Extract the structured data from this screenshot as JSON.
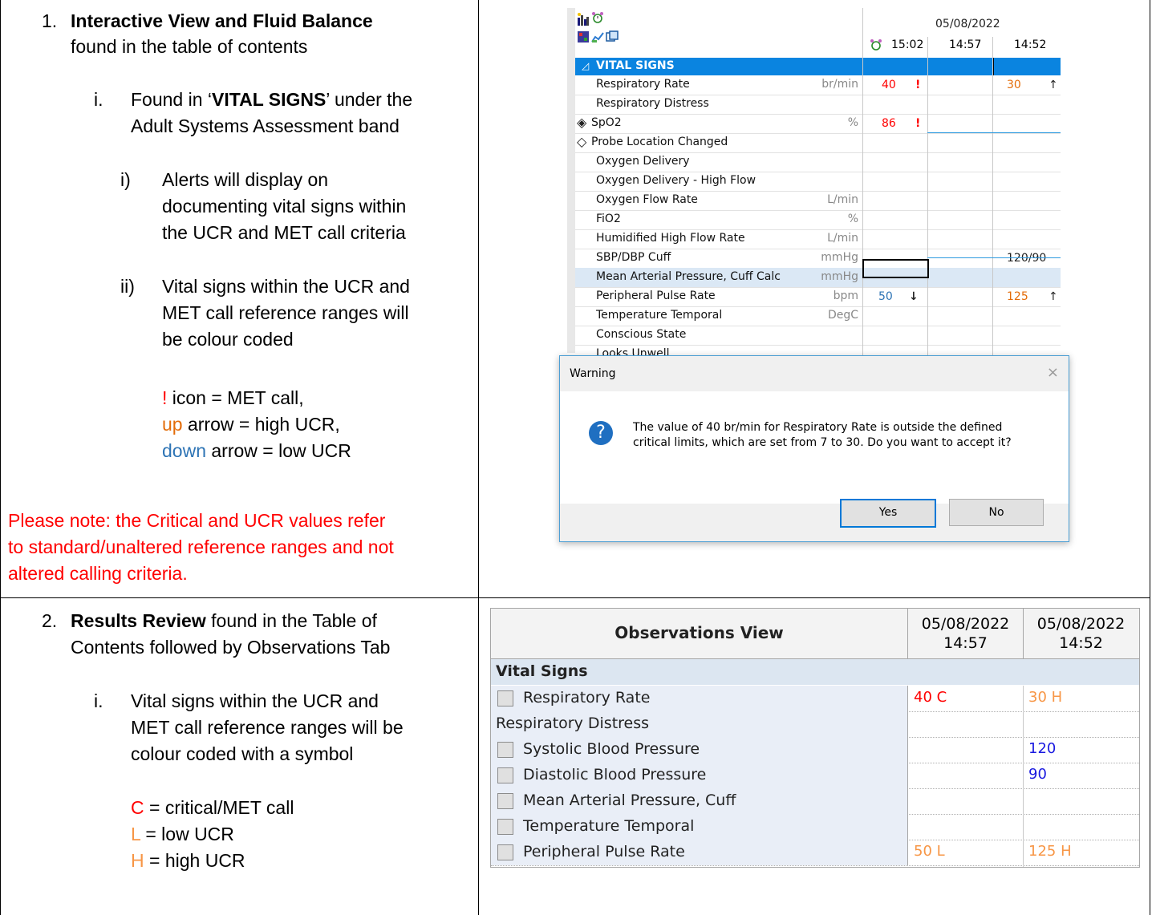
{
  "section1": {
    "num": "1.",
    "title": "Interactive View and Fluid Balance",
    "title_suffix": "found in the table of contents",
    "item_i_num": "i.",
    "item_i_pre": "Found in ‘",
    "item_i_bold": "VITAL SIGNS",
    "item_i_post": "’ under the",
    "item_i_line2": "Adult Systems Assessment band",
    "sub_i_num": "i)",
    "sub_i_lines": [
      "Alerts will display on",
      "documenting vital signs within",
      "the UCR and MET call criteria"
    ],
    "sub_ii_num": "ii)",
    "sub_ii_lines": [
      "Vital signs within the UCR and",
      "MET call reference ranges will",
      "be colour coded"
    ],
    "legend1_sym": "!",
    "legend1_text": " icon = MET call,",
    "legend2_sym": "up",
    "legend2_text": " arrow = high UCR,",
    "legend3_sym": "down",
    "legend3_text": " arrow = low UCR",
    "note_lines": [
      "Please note: the Critical and UCR values refer",
      "to standard/unaltered reference ranges and not",
      "altered calling criteria."
    ]
  },
  "section2": {
    "num": "2.",
    "title": "Results Review",
    "title_suffix": " found in the Table of",
    "line2": "Contents followed by Observations Tab",
    "item_i_num": "i.",
    "item_i_lines": [
      "Vital signs within the UCR and",
      "MET call reference ranges will be",
      "colour coded with a symbol"
    ],
    "legend1_sym": "C",
    "legend1_text": " = critical/MET call",
    "legend2_sym": "L",
    "legend2_text": " = low UCR",
    "legend3_sym": "H",
    "legend3_text": " = high UCR"
  },
  "iview": {
    "date": "05/08/2022",
    "times": [
      "15:02",
      "14:57",
      "14:52"
    ],
    "section": "VITAL SIGNS",
    "rows": [
      {
        "label": "Respiratory Rate",
        "unit": "br/min",
        "v1": "40",
        "f1": "!",
        "v2": "30",
        "f2": "↑"
      },
      {
        "label": "Respiratory Distress",
        "unit": "",
        "v1": "",
        "f1": "",
        "v2": "",
        "f2": ""
      },
      {
        "label": "SpO2",
        "unit": "%",
        "v1": "86",
        "f1": "!",
        "v2": "",
        "f2": ""
      },
      {
        "label": "Probe Location Changed",
        "unit": "",
        "v1": "",
        "f1": "",
        "v2": "",
        "f2": ""
      },
      {
        "label": "Oxygen Delivery",
        "unit": "",
        "v1": "",
        "f1": "",
        "v2": "",
        "f2": ""
      },
      {
        "label": "Oxygen Delivery - High Flow",
        "unit": "",
        "v1": "",
        "f1": "",
        "v2": "",
        "f2": ""
      },
      {
        "label": "Oxygen Flow Rate",
        "unit": "L/min",
        "v1": "",
        "f1": "",
        "v2": "",
        "f2": ""
      },
      {
        "label": "FiO2",
        "unit": "%",
        "v1": "",
        "f1": "",
        "v2": "",
        "f2": ""
      },
      {
        "label": "Humidified High Flow Rate",
        "unit": "L/min",
        "v1": "",
        "f1": "",
        "v2": "",
        "f2": ""
      },
      {
        "label": "SBP/DBP Cuff",
        "unit": "mmHg",
        "v1": "",
        "f1": "",
        "v2": "120/90",
        "f2": ""
      },
      {
        "label": "Mean Arterial Pressure, Cuff Calc",
        "unit": "mmHg",
        "v1": "",
        "f1": "",
        "v2": "",
        "f2": ""
      },
      {
        "label": "Peripheral Pulse Rate",
        "unit": "bpm",
        "v1": "50",
        "f1": "↓",
        "v2": "125",
        "f2": "↑"
      },
      {
        "label": "Temperature Temporal",
        "unit": "DegC",
        "v1": "",
        "f1": "",
        "v2": "",
        "f2": ""
      },
      {
        "label": "Conscious State",
        "unit": "",
        "v1": "",
        "f1": "",
        "v2": "",
        "f2": ""
      },
      {
        "label": "Looks Unwell",
        "unit": "",
        "v1": "",
        "f1": "",
        "v2": "",
        "f2": ""
      }
    ]
  },
  "dialog": {
    "title": "Warning",
    "close": "×",
    "icon": "?",
    "line1": "The value of 40 br/min for Respiratory Rate is outside the defined",
    "line2": "critical limits, which are set from 7 to 30.  Do you want to accept it?",
    "yes": "Yes",
    "no": "No"
  },
  "results": {
    "header": "Observations View",
    "col1_date": "05/08/2022",
    "col1_time": "14:57",
    "col2_date": "05/08/2022",
    "col2_time": "14:52",
    "section": "Vital Signs",
    "rows": [
      {
        "label": "Respiratory Rate",
        "v1": "40 C",
        "v2": "30 H",
        "checkbox": true
      },
      {
        "label": "Respiratory Distress",
        "v1": "",
        "v2": "",
        "checkbox": false
      },
      {
        "label": "Systolic Blood Pressure",
        "v1": "",
        "v2": "120",
        "checkbox": true
      },
      {
        "label": "Diastolic Blood Pressure",
        "v1": "",
        "v2": "90",
        "checkbox": true
      },
      {
        "label": "Mean Arterial Pressure, Cuff",
        "v1": "",
        "v2": "",
        "checkbox": true
      },
      {
        "label": "Temperature Temporal",
        "v1": "",
        "v2": "",
        "checkbox": true
      },
      {
        "label": "Peripheral Pulse Rate",
        "v1": "50 L",
        "v2": "125 H",
        "checkbox": true
      }
    ]
  },
  "colors": {
    "critical": "#ff0000",
    "high": "#e36c09",
    "low": "#2e74b5",
    "ucr_light": "#f79646",
    "dialog_border": "#4d9fd4",
    "iview_section": "#0a84e0"
  }
}
